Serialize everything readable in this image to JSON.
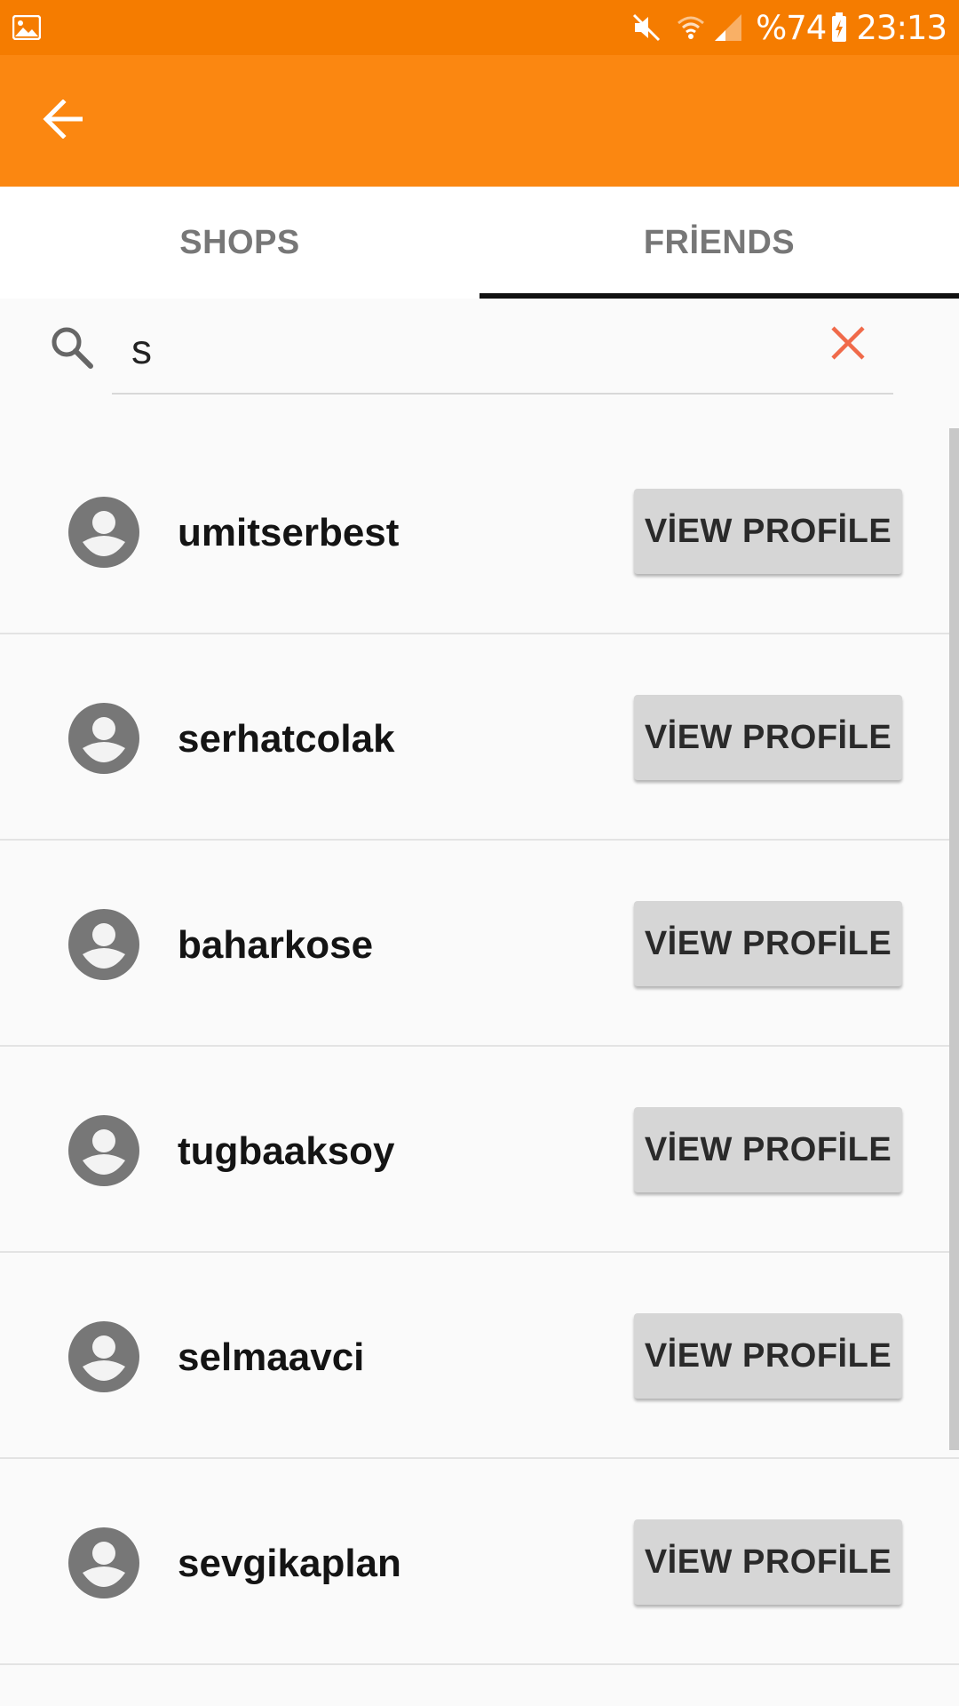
{
  "status_bar": {
    "battery": "%74",
    "time": "23:13",
    "icons": [
      "gallery-icon",
      "mute-icon",
      "wifi-icon",
      "signal-icon",
      "battery-charging-icon"
    ]
  },
  "app_bar": {
    "back_icon": "arrow-back-icon"
  },
  "tabs": [
    {
      "label": "SHOPS",
      "selected": false
    },
    {
      "label": "FRİENDS",
      "selected": true
    }
  ],
  "search": {
    "value": "s",
    "search_icon": "search-icon",
    "clear_icon": "close-icon"
  },
  "friends": [
    {
      "username": "umitserbest",
      "button": "VİEW PROFİLE"
    },
    {
      "username": "serhatcolak",
      "button": "VİEW PROFİLE"
    },
    {
      "username": "baharkose",
      "button": "VİEW PROFİLE"
    },
    {
      "username": "tugbaaksoy",
      "button": "VİEW PROFİLE"
    },
    {
      "username": "selmaavci",
      "button": "VİEW PROFİLE"
    },
    {
      "username": "sevgikaplan",
      "button": "VİEW PROFİLE"
    }
  ],
  "colors": {
    "status_bar": "#f57c00",
    "app_bar": "#fb8711",
    "clear_icon": "#f06a4a",
    "tab_indicator": "#111111"
  }
}
